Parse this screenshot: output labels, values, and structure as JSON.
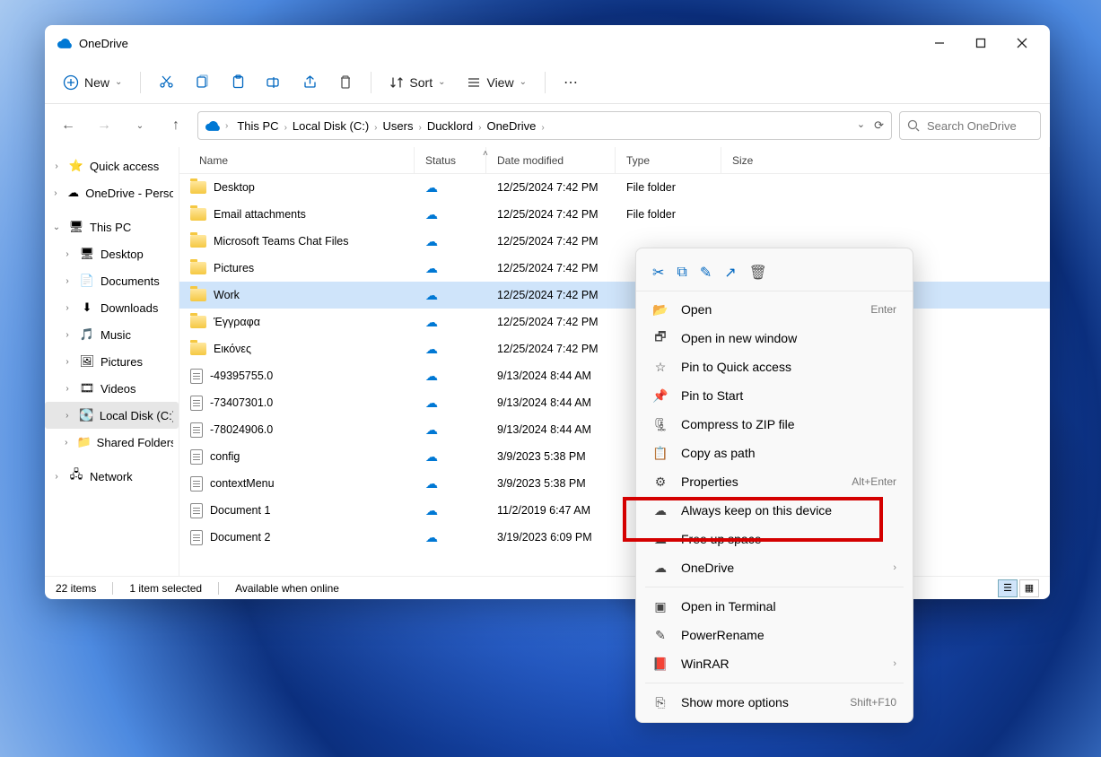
{
  "title": "OneDrive",
  "toolbar": {
    "new": "New",
    "sort": "Sort",
    "view": "View"
  },
  "breadcrumb": [
    "This PC",
    "Local Disk (C:)",
    "Users",
    "Ducklord",
    "OneDrive"
  ],
  "search": {
    "placeholder": "Search OneDrive"
  },
  "columns": {
    "name": "Name",
    "status": "Status",
    "date": "Date modified",
    "type": "Type",
    "size": "Size"
  },
  "sidebar": [
    {
      "label": "Quick access",
      "icon": "star",
      "chv": "›"
    },
    {
      "label": "OneDrive - Persona",
      "icon": "onedrive",
      "chv": "›"
    },
    {
      "label": "This PC",
      "icon": "pc",
      "chv": "⌄",
      "bold": true
    },
    {
      "label": "Desktop",
      "icon": "desktop",
      "chv": "›",
      "indent": true
    },
    {
      "label": "Documents",
      "icon": "docs",
      "chv": "›",
      "indent": true
    },
    {
      "label": "Downloads",
      "icon": "down",
      "chv": "›",
      "indent": true
    },
    {
      "label": "Music",
      "icon": "music",
      "chv": "›",
      "indent": true
    },
    {
      "label": "Pictures",
      "icon": "pics",
      "chv": "›",
      "indent": true
    },
    {
      "label": "Videos",
      "icon": "vids",
      "chv": "›",
      "indent": true
    },
    {
      "label": "Local Disk (C:)",
      "icon": "disk",
      "chv": "›",
      "indent": true,
      "sel": true
    },
    {
      "label": "Shared Folders (\\\\",
      "icon": "share",
      "chv": "›",
      "indent": true
    },
    {
      "label": "Network",
      "icon": "net",
      "chv": "›"
    }
  ],
  "files": [
    {
      "name": "Desktop",
      "kind": "folder",
      "date": "12/25/2024 7:42 PM",
      "type": "File folder"
    },
    {
      "name": "Email attachments",
      "kind": "folder",
      "date": "12/25/2024 7:42 PM",
      "type": "File folder"
    },
    {
      "name": "Microsoft Teams Chat Files",
      "kind": "folder",
      "date": "12/25/2024 7:42 PM",
      "type": ""
    },
    {
      "name": "Pictures",
      "kind": "folder",
      "date": "12/25/2024 7:42 PM",
      "type": ""
    },
    {
      "name": "Work",
      "kind": "folder",
      "date": "12/25/2024 7:42 PM",
      "type": "",
      "sel": true
    },
    {
      "name": "Έγγραφα",
      "kind": "folder",
      "date": "12/25/2024 7:42 PM",
      "type": ""
    },
    {
      "name": "Εικόνες",
      "kind": "folder",
      "date": "12/25/2024 7:42 PM",
      "type": ""
    },
    {
      "name": "-49395755.0",
      "kind": "file",
      "date": "9/13/2024 8:44 AM",
      "type": ""
    },
    {
      "name": "-73407301.0",
      "kind": "file",
      "date": "9/13/2024 8:44 AM",
      "type": ""
    },
    {
      "name": "-78024906.0",
      "kind": "file",
      "date": "9/13/2024 8:44 AM",
      "type": ""
    },
    {
      "name": "config",
      "kind": "file",
      "date": "3/9/2023 5:38 PM",
      "type": ""
    },
    {
      "name": "contextMenu",
      "kind": "file",
      "date": "3/9/2023 5:38 PM",
      "type": ""
    },
    {
      "name": "Document 1",
      "kind": "file",
      "date": "11/2/2019 6:47 AM",
      "type": ""
    },
    {
      "name": "Document 2",
      "kind": "file",
      "date": "3/19/2023 6:09 PM",
      "type": ""
    }
  ],
  "status": {
    "count": "22 items",
    "sel": "1 item selected",
    "avail": "Available when online"
  },
  "ctx": [
    {
      "label": "Open",
      "hint": "Enter",
      "icon": "open"
    },
    {
      "label": "Open in new window",
      "icon": "new-win"
    },
    {
      "label": "Pin to Quick access",
      "icon": "star-o"
    },
    {
      "label": "Pin to Start",
      "icon": "pin"
    },
    {
      "label": "Compress to ZIP file",
      "icon": "zip"
    },
    {
      "label": "Copy as path",
      "icon": "path"
    },
    {
      "label": "Properties",
      "hint": "Alt+Enter",
      "icon": "props"
    },
    {
      "label": "Always keep on this device",
      "icon": "cloud-keep"
    },
    {
      "label": "Free up space",
      "icon": "cloud-free"
    },
    {
      "label": "OneDrive",
      "icon": "onedrive",
      "sub": "›"
    },
    {
      "sep": true
    },
    {
      "label": "Open in Terminal",
      "icon": "term"
    },
    {
      "label": "PowerRename",
      "icon": "rename"
    },
    {
      "label": "WinRAR",
      "icon": "rar",
      "sub": "›"
    },
    {
      "sep": true
    },
    {
      "label": "Show more options",
      "hint": "Shift+F10",
      "icon": "more"
    }
  ]
}
